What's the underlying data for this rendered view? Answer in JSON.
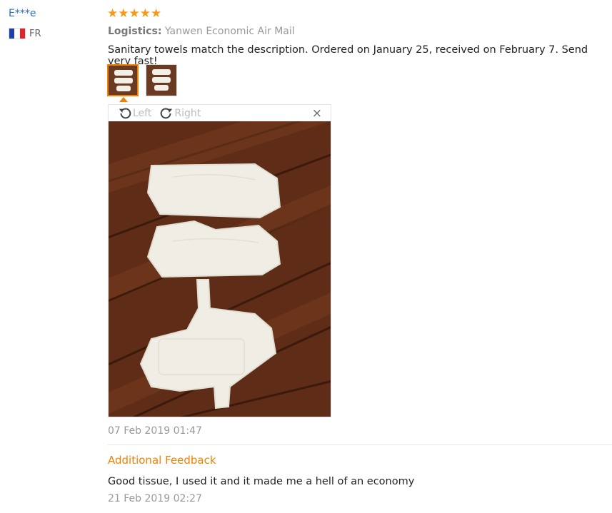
{
  "reviewer": {
    "name": "E***e",
    "country_code": "FR",
    "flag_colors": [
      "#1f3fa8",
      "#ffffff",
      "#e0242c"
    ]
  },
  "review": {
    "rating": 5,
    "stars": [
      "★",
      "★",
      "★",
      "★",
      "★"
    ],
    "logistics_label": "Logistics:",
    "logistics_value": "Yanwen Economic Air Mail",
    "text": "Sanitary towels match the description. Ordered on January 25, received on February 7. Send very fast!",
    "date": "07 Feb 2019 01:47",
    "thumbnails": [
      "photo-1",
      "photo-2"
    ],
    "selected_thumbnail": 0
  },
  "viewer": {
    "rotate_left_label": "Left",
    "rotate_right_label": "Right",
    "close_label": "×"
  },
  "additional_feedback": {
    "title": "Additional Feedback",
    "text": "Good tissue, I used it and it made me a hell of an economy",
    "date": "21 Feb 2019 02:27"
  },
  "colors": {
    "accent": "#f08200",
    "link": "#2a6fbd",
    "star": "#f79a17"
  }
}
